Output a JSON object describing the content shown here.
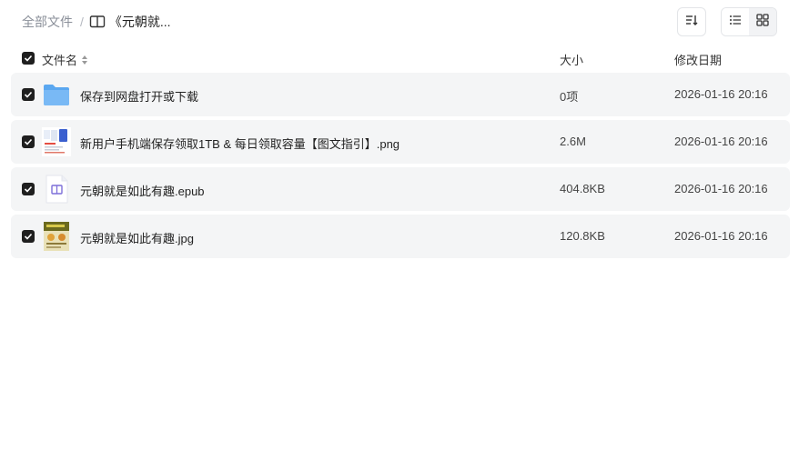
{
  "breadcrumb": {
    "root": "全部文件",
    "separator": "/",
    "current": "《元朝就..."
  },
  "toolbar": {
    "sort_icon": "sort-icon",
    "list_view_icon": "list-view-icon",
    "grid_view_icon": "grid-view-icon"
  },
  "columns": {
    "name": "文件名",
    "size": "大小",
    "modified": "修改日期"
  },
  "files": [
    {
      "name": "保存到网盘打开或下载",
      "size": "0项",
      "date": "2026-01-16 20:16",
      "icon": "folder-icon",
      "checked": true
    },
    {
      "name": "新用户手机端保存领取1TB & 每日领取容量【图文指引】.png",
      "size": "2.6M",
      "date": "2026-01-16 20:16",
      "icon": "image-thumbnail",
      "checked": true
    },
    {
      "name": "元朝就是如此有趣.epub",
      "size": "404.8KB",
      "date": "2026-01-16 20:16",
      "icon": "epub-icon",
      "checked": true
    },
    {
      "name": "元朝就是如此有趣.jpg",
      "size": "120.8KB",
      "date": "2026-01-16 20:16",
      "icon": "book-cover-thumbnail",
      "checked": true
    }
  ],
  "colors": {
    "row_bg": "#f4f5f6",
    "checkbox": "#1f1f1f",
    "folder": "#5aa7f0"
  }
}
